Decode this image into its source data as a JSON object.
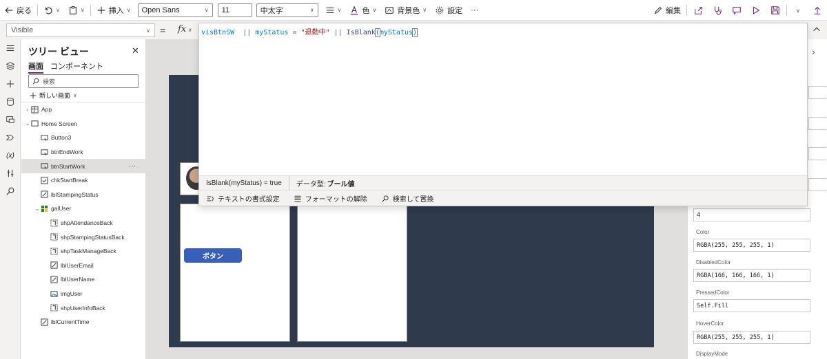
{
  "toolbar": {
    "back": "戻る",
    "insert": "挿入",
    "font": "Open Sans",
    "font_size": "11",
    "font_weight": "中太字",
    "color": "色",
    "background_color": "背景色",
    "settings": "設定",
    "more": "···",
    "edit": "編集"
  },
  "formula_bar": {
    "property": "Visible",
    "equals": "=",
    "fx": "fx",
    "code": {
      "p1": "visBtnSW",
      "p2": "  || ",
      "p3": "myStatus",
      "p4": " = ",
      "p5": "\"退勤中\"",
      "p6": " || ",
      "p7": "IsBlank",
      "p8": "(",
      "p9": "myStatus",
      "p10": ")"
    },
    "eval_expression": "IsBlank(myStatus)  =  true",
    "data_type_label": "データ型:",
    "data_type_value": "ブール値",
    "tool_format": "テキストの書式設定",
    "tool_unformat": "フォーマットの解除",
    "tool_find": "検索して置換"
  },
  "tree": {
    "title": "ツリー ビュー",
    "tab_screens": "画面",
    "tab_components": "コンポーネント",
    "search_placeholder": "検索",
    "new_screen": "新しい画面",
    "more": "···",
    "items": [
      {
        "label": "App",
        "icon": "app-icon"
      },
      {
        "label": "Home Screen",
        "icon": "screen-icon"
      },
      {
        "label": "Button3",
        "icon": "button-icon"
      },
      {
        "label": "btnEndWork",
        "icon": "button-icon"
      },
      {
        "label": "btnStartWork",
        "icon": "button-icon"
      },
      {
        "label": "chkStartBreak",
        "icon": "checkbox-icon"
      },
      {
        "label": "lblStampingStatus",
        "icon": "label-icon"
      },
      {
        "label": "galUser",
        "icon": "gallery-icon"
      },
      {
        "label": "shpAttendanceBack",
        "icon": "shape-icon"
      },
      {
        "label": "shpStampingStatusBack",
        "icon": "shape-icon"
      },
      {
        "label": "shpTaskManageBack",
        "icon": "shape-icon"
      },
      {
        "label": "lblUserEmail",
        "icon": "label-icon"
      },
      {
        "label": "lblUserName",
        "icon": "label-icon"
      },
      {
        "label": "imgUser",
        "icon": "image-icon"
      },
      {
        "label": "shpUserInfoBack",
        "icon": "shape-icon"
      },
      {
        "label": "lblCurrentTime",
        "icon": "label-icon"
      }
    ]
  },
  "canvas": {
    "button_text": "ボタン"
  },
  "properties": {
    "value_4": "4",
    "color_label": "Color",
    "color_value": "RGBA(255, 255, 255, 1)",
    "disabled_label": "DisabledColor",
    "disabled_value": "RGBA(166, 166, 166, 1)",
    "pressed_label": "PressedColor",
    "pressed_value": "Self.Fill",
    "hover_label": "HoverColor",
    "hover_value": "RGBA(255, 255, 255, 1)",
    "display_label": "DisplayMode"
  },
  "colors": {
    "accent": "#742774",
    "screen_bg": "#2f3a4c",
    "button": "#3860b8"
  }
}
